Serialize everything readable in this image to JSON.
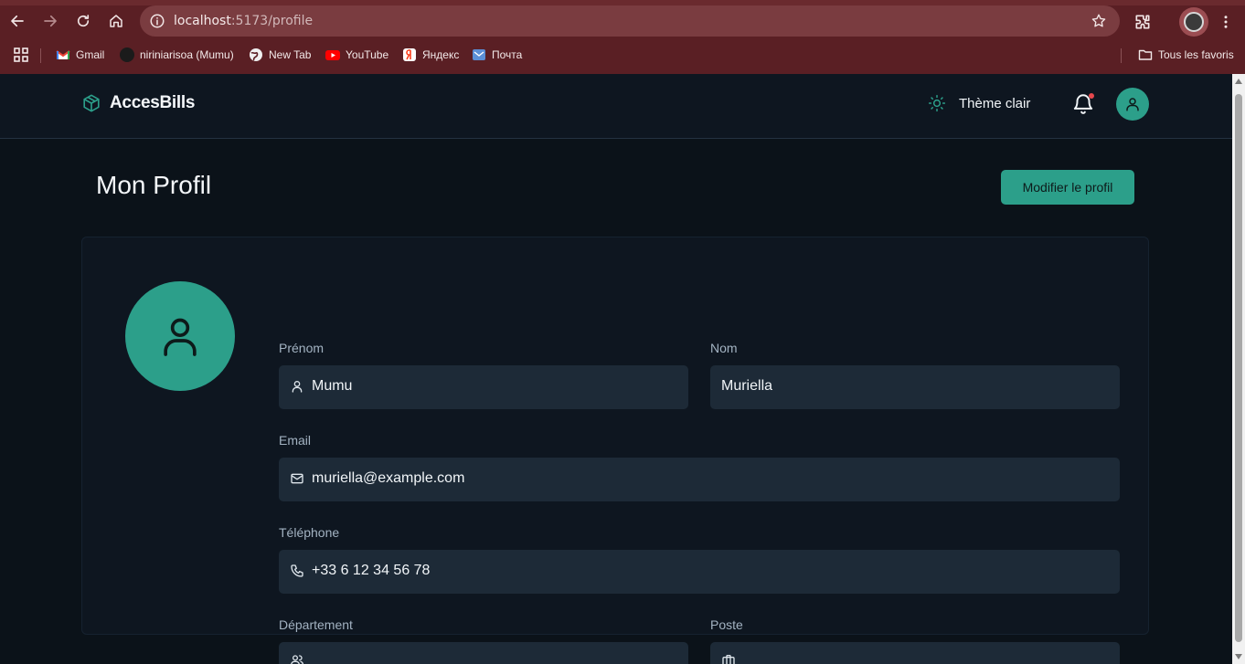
{
  "browser": {
    "url_host": "localhost",
    "url_path": ":5173/profile",
    "bookmarks": [
      {
        "label": "Gmail",
        "color": "#ea4335"
      },
      {
        "label": "niriniarisoa (Mumu)",
        "color": "#1b1b1b"
      },
      {
        "label": "New Tab",
        "color": "#e8e8e8"
      },
      {
        "label": "YouTube",
        "color": "#ff0000"
      },
      {
        "label": "Яндекс",
        "color": "#fc3f1d"
      },
      {
        "label": "Почта",
        "color": "#5b8fd6"
      }
    ],
    "all_bookmarks": "Tous les favoris"
  },
  "header": {
    "brand": "AccesBills",
    "theme_label": "Thème clair",
    "has_notification": true
  },
  "page": {
    "title": "Mon Profil",
    "edit_button": "Modifier le profil"
  },
  "form": {
    "first_name": {
      "label": "Prénom",
      "value": "Mumu",
      "icon": "user-icon"
    },
    "last_name": {
      "label": "Nom",
      "value": "Muriella"
    },
    "email": {
      "label": "Email",
      "value": "muriella@example.com",
      "icon": "mail-icon"
    },
    "phone": {
      "label": "Téléphone",
      "value": "+33 6 12 34 56 78",
      "icon": "phone-icon"
    },
    "department": {
      "label": "Département",
      "value": "",
      "icon": "users-icon"
    },
    "position": {
      "label": "Poste",
      "value": "",
      "icon": "briefcase-icon"
    }
  },
  "colors": {
    "accent": "#2c9f8a",
    "background": "#0b1219",
    "card": "#0e1620",
    "input": "#1d2a37",
    "chrome": "#5a1f24",
    "notification_dot": "#e5484d"
  }
}
